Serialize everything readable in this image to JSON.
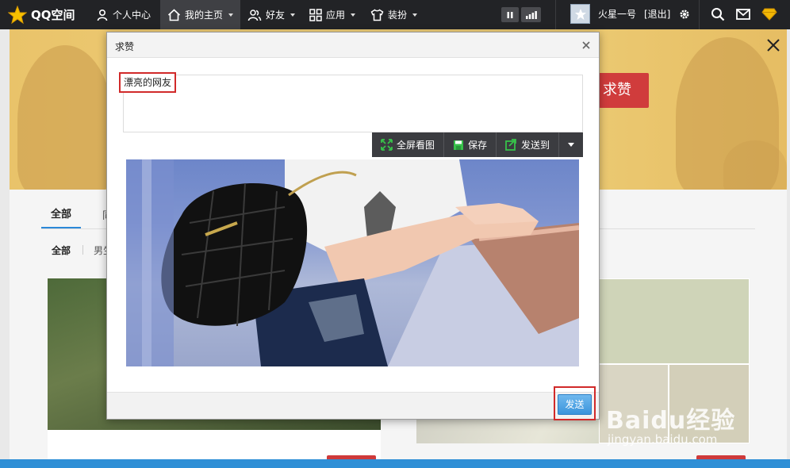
{
  "topbar": {
    "logo": "QQ空间",
    "nav": [
      {
        "label": "个人中心",
        "icon": "user-icon"
      },
      {
        "label": "我的主页",
        "icon": "home-icon",
        "active": true
      },
      {
        "label": "好友",
        "icon": "friends-icon"
      },
      {
        "label": "应用",
        "icon": "grid-icon"
      },
      {
        "label": "装扮",
        "icon": "shirt-icon"
      }
    ],
    "username": "火星一号",
    "logout": "[退出]"
  },
  "banner": {
    "cta": "求赞"
  },
  "content": {
    "tab_all": "全部",
    "tab_2_partial": "同",
    "filter_all": "全部",
    "filter_2_partial": "男生"
  },
  "modal": {
    "title": "求赞",
    "text_value": "漂亮的网友",
    "toolbar": {
      "fullscreen": "全屏看图",
      "save": "保存",
      "send_to": "发送到"
    },
    "send": "发送"
  },
  "watermark": {
    "main": "Baidu经验",
    "sub": "jingyan.baidu.com"
  },
  "colors": {
    "topbar": "#222326",
    "accent_red": "#d12a2a",
    "send_blue": "#3b95dc",
    "banner_gold": "#f0cf78"
  }
}
